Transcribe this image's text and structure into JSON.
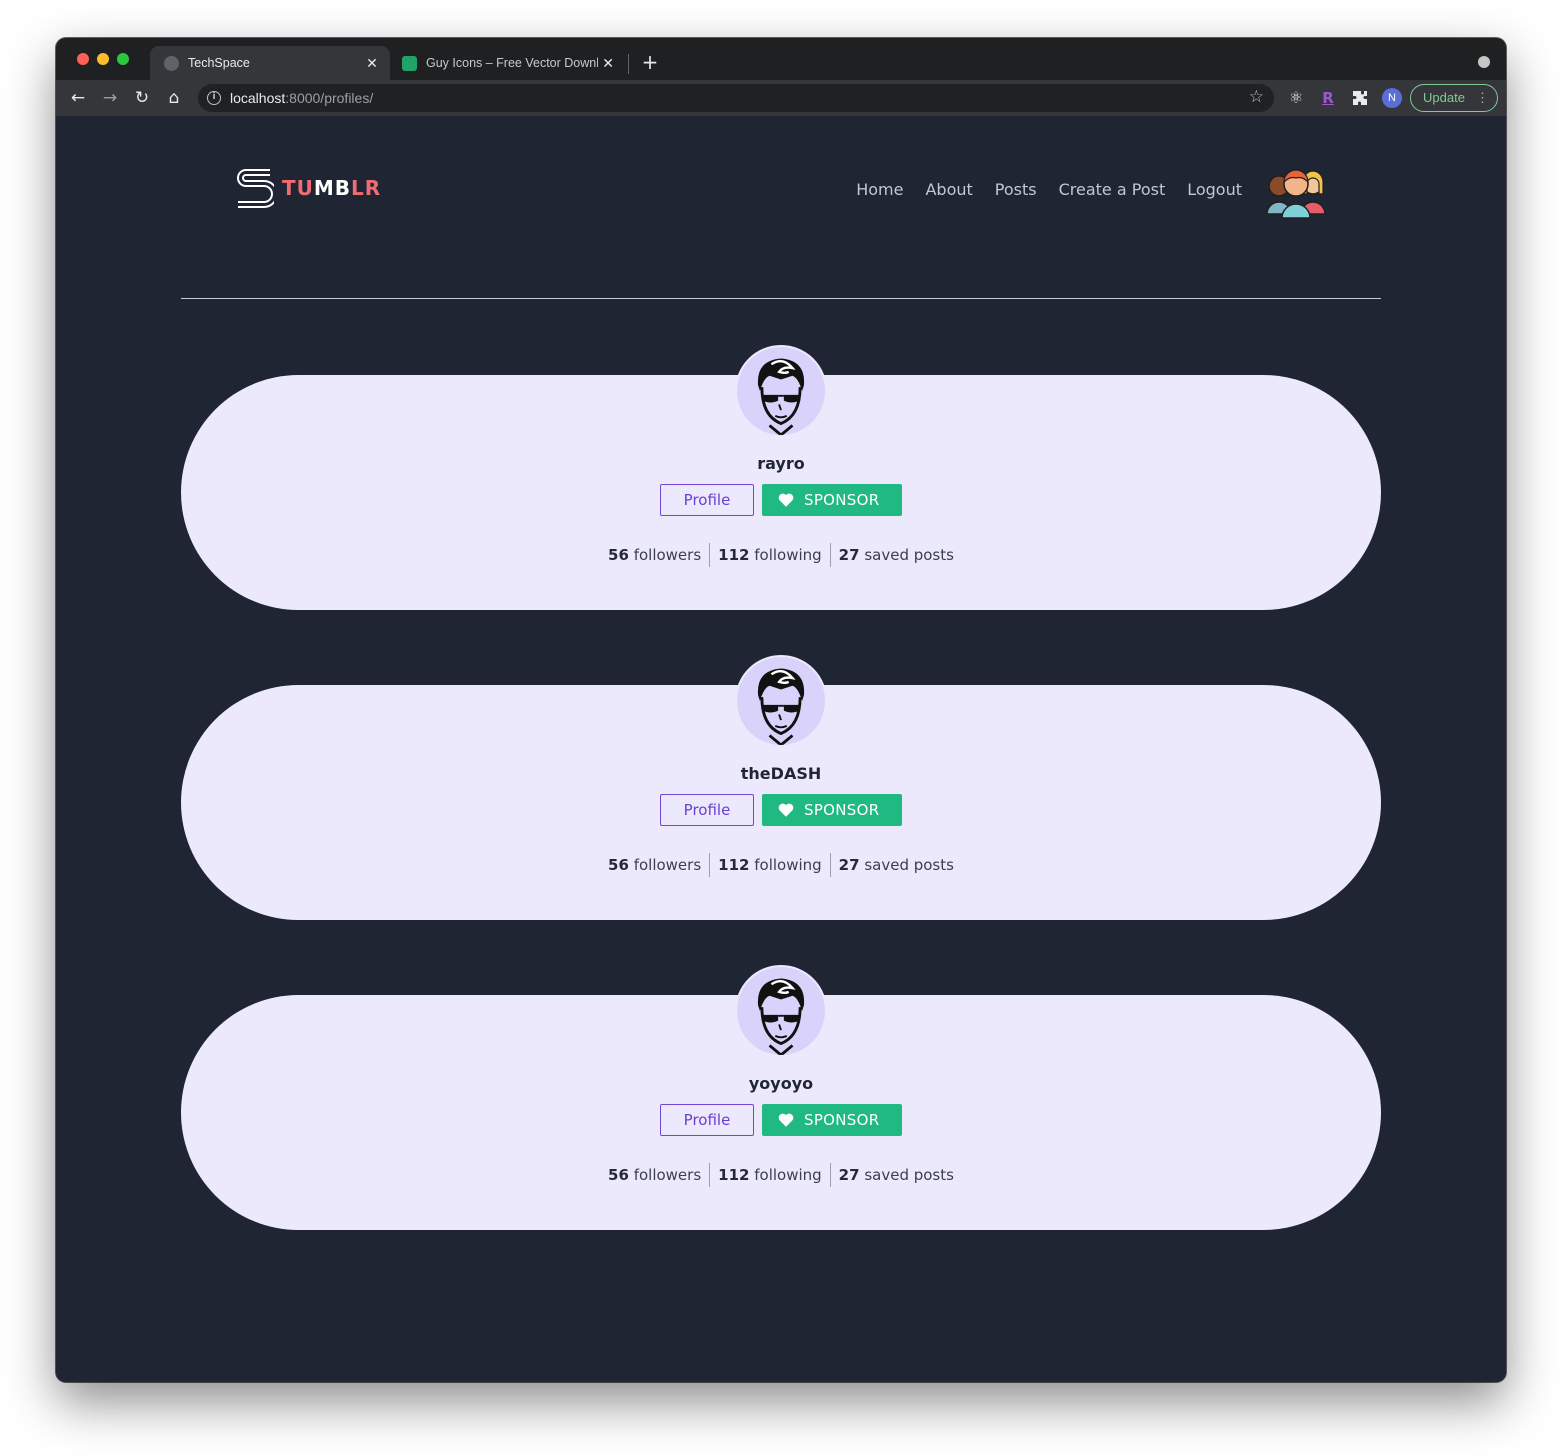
{
  "browser": {
    "tabs": [
      {
        "title": "TechSpace",
        "close": "✕"
      },
      {
        "title": "Guy Icons – Free Vector Downl",
        "close": "✕"
      }
    ],
    "new_tab": "+",
    "url_host": "localhost",
    "url_path": ":8000/profiles/",
    "profile_initial": "N",
    "update_label": "Update",
    "update_menu": "⋮",
    "extension_letter": "R"
  },
  "site": {
    "logo_part1": "TU",
    "logo_part2": "MB",
    "logo_part3": "LR",
    "nav": [
      "Home",
      "About",
      "Posts",
      "Create a Post",
      "Logout"
    ],
    "colors": {
      "accent": "#f06b72",
      "sponsor": "#21b982",
      "profile": "#7446d6",
      "card": "#ede9fd",
      "background": "#1f2533"
    }
  },
  "profiles": [
    {
      "username": "rayro",
      "profile_label": "Profile",
      "sponsor_label": "SPONSOR",
      "followers": "56",
      "followers_label": "followers",
      "following": "112",
      "following_label": "following",
      "saved": "27",
      "saved_label": "saved posts"
    },
    {
      "username": "theDASH",
      "profile_label": "Profile",
      "sponsor_label": "SPONSOR",
      "followers": "56",
      "followers_label": "followers",
      "following": "112",
      "following_label": "following",
      "saved": "27",
      "saved_label": "saved posts"
    },
    {
      "username": "yoyoyo",
      "profile_label": "Profile",
      "sponsor_label": "SPONSOR",
      "followers": "56",
      "followers_label": "followers",
      "following": "112",
      "following_label": "following",
      "saved": "27",
      "saved_label": "saved posts"
    }
  ]
}
